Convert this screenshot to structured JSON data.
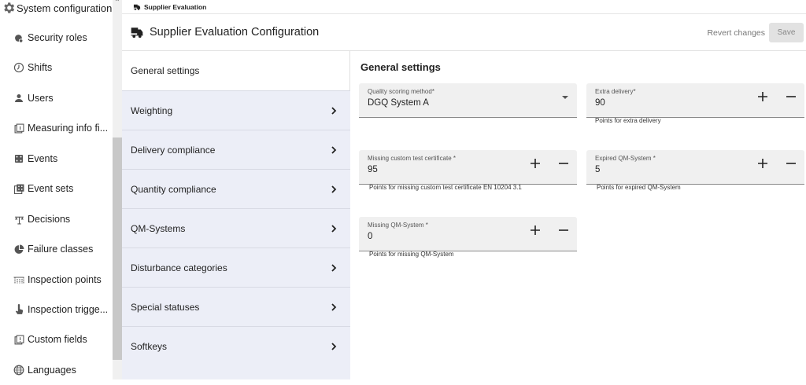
{
  "nav": {
    "header": "System configuration",
    "items": [
      {
        "label": "Security roles",
        "icon": "security-roles-icon"
      },
      {
        "label": "Shifts",
        "icon": "clock-icon"
      },
      {
        "label": "Users",
        "icon": "user-icon"
      },
      {
        "label": "Measuring info fi...",
        "icon": "measuring-info-icon"
      },
      {
        "label": "Events",
        "icon": "events-icon"
      },
      {
        "label": "Event sets",
        "icon": "event-sets-icon"
      },
      {
        "label": "Decisions",
        "icon": "decisions-icon"
      },
      {
        "label": "Failure classes",
        "icon": "pie-chart-icon"
      },
      {
        "label": "Inspection points",
        "icon": "inspection-points-icon"
      },
      {
        "label": "Inspection trigge...",
        "icon": "touch-icon"
      },
      {
        "label": "Custom fields",
        "icon": "custom-fields-icon"
      },
      {
        "label": "Languages",
        "icon": "globe-icon"
      }
    ]
  },
  "breadcrumb": "Supplier Evaluation",
  "page_title": "Supplier Evaluation Configuration",
  "toolbar": {
    "revert_label": "Revert changes",
    "save_label": "Save"
  },
  "settings_list": {
    "header": "General settings",
    "items": [
      "Weighting",
      "Delivery compliance",
      "Quantity compliance",
      "QM-Systems",
      "Disturbance categories",
      "Special statuses",
      "Softkeys"
    ]
  },
  "form": {
    "title": "General settings",
    "quality_method": {
      "label": "Quality scoring method*",
      "value": "DGQ System A"
    },
    "extra_delivery": {
      "label": "Extra delivery*",
      "value": "90",
      "hint": "Points for extra delivery"
    },
    "missing_cert": {
      "label": "Missing custom test certificate *",
      "value": "95",
      "hint": "Points for missing custom test certificate EN 10204 3.1"
    },
    "expired_qm": {
      "label": "Expired QM-System *",
      "value": "5",
      "hint": "Points for expired QM-System"
    },
    "missing_qm": {
      "label": "Missing QM-System *",
      "value": "0",
      "hint": "Points for missing QM-System"
    }
  }
}
